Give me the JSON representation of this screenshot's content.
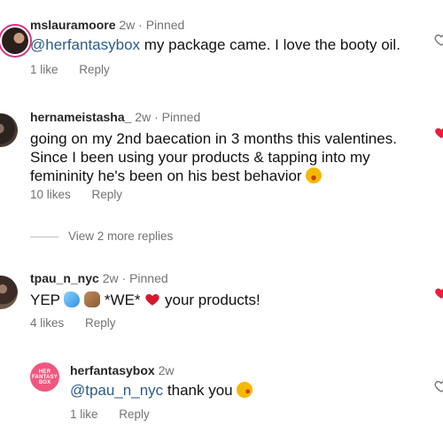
{
  "comments": [
    {
      "username": "mslauramoore",
      "time": "2w",
      "pinned": "Pinned",
      "mention": "@herfantasybox",
      "text": " my package came. I love the booty oil.",
      "likes": "1 like",
      "reply": "Reply",
      "liked": false
    },
    {
      "username": "hernameistasha_",
      "time": "2w",
      "pinned": "Pinned",
      "text": "going on my 2nd baecation in 3 months this valentines. Since I been using your products & tapping into my femininity he's been on his best behavior",
      "likes": "10 likes",
      "reply": "Reply",
      "liked": true
    },
    {
      "username": "tpau_n_nyc",
      "time": "2w",
      "pinned": "Pinned",
      "text_a": "YEP",
      "text_b": "*WE*",
      "text_c": "your products!",
      "likes": "4 likes",
      "reply": "Reply",
      "liked": true
    }
  ],
  "more_replies": "View 2 more replies",
  "reply_comment": {
    "username": "herfantasybox",
    "time": "2w",
    "mention": "@tpau_n_nyc",
    "text": " thank you",
    "likes": "1 like",
    "reply": "Reply",
    "liked": false,
    "avatar_text": [
      "HER",
      "FANTASY",
      "BOX"
    ]
  },
  "colors": {
    "mention": "#2b5c8a",
    "heart_red": "#ed1c3b",
    "brand_pink": "#f0577f"
  },
  "icons": [
    "heart-icon",
    "heart-filled-icon",
    "sweat-droplets-emoji",
    "clapping-hands-emoji",
    "red-heart-emoji",
    "laughing-emoji",
    "kiss-emoji"
  ]
}
